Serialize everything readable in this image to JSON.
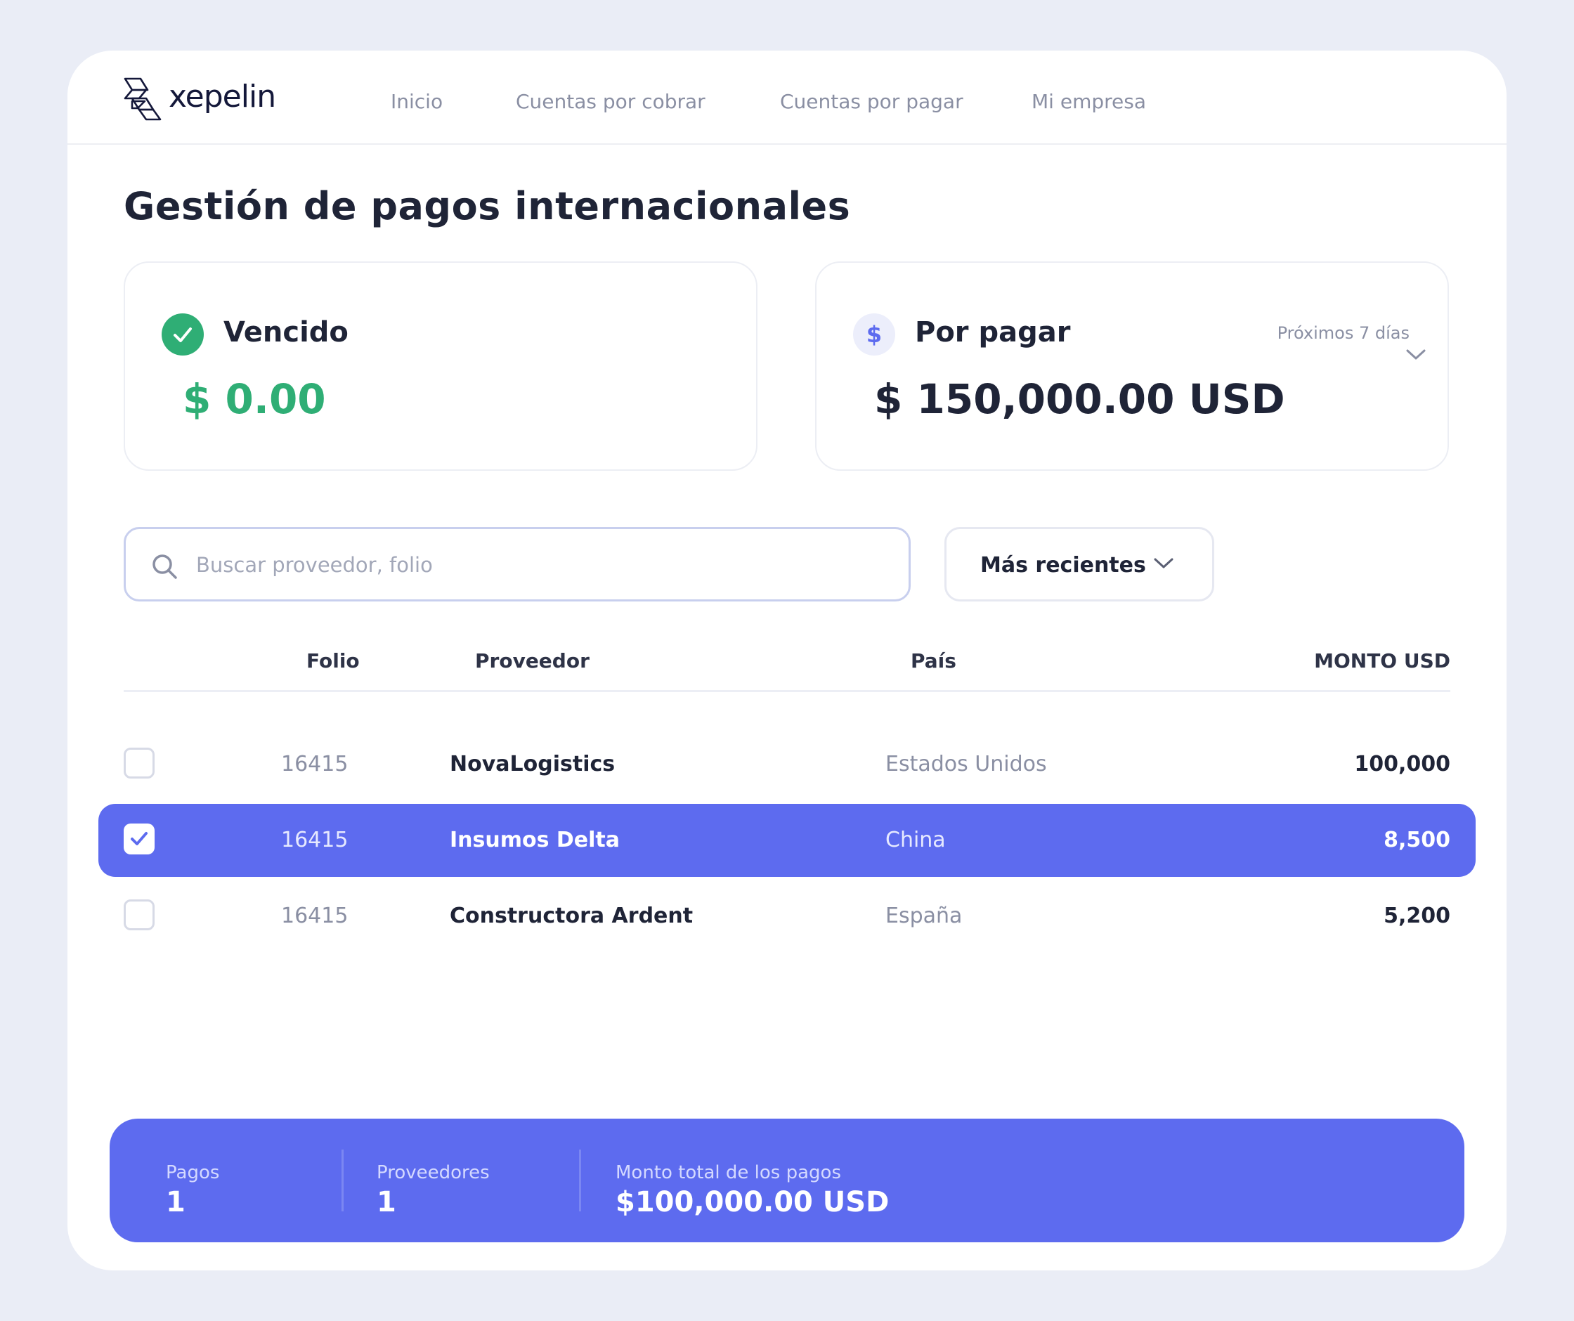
{
  "brand": {
    "name": "xepelin"
  },
  "nav": {
    "items": [
      "Inicio",
      "Cuentas por cobrar",
      "Cuentas por pagar",
      "Mi empresa"
    ]
  },
  "page": {
    "title": "Gestión de pagos internacionales"
  },
  "cards": {
    "vencido": {
      "label": "Vencido",
      "amount": "$ 0.00",
      "icon": "check-circle-icon",
      "color": "#2fae75"
    },
    "por_pagar": {
      "label": "Por pagar",
      "amount": "$ 150,000.00 USD",
      "period": "Próximos 7 días",
      "icon": "dollar-icon",
      "color": "#5d6bef"
    }
  },
  "search": {
    "placeholder": "Buscar proveedor, folio",
    "value": ""
  },
  "sort": {
    "label": "Más recientes"
  },
  "table": {
    "headers": {
      "folio": "Folio",
      "proveedor": "Proveedor",
      "pais": "País",
      "monto": "MONTO USD"
    },
    "rows": [
      {
        "folio": "16415",
        "proveedor": "NovaLogistics",
        "pais": "Estados Unidos",
        "monto": "100,000",
        "selected": false
      },
      {
        "folio": "16415",
        "proveedor": "Insumos Delta",
        "pais": "China",
        "monto": "8,500",
        "selected": true
      },
      {
        "folio": "16415",
        "proveedor": "Constructora Ardent",
        "pais": "España",
        "monto": "5,200",
        "selected": false
      }
    ]
  },
  "summary": {
    "pagos_label": "Pagos",
    "pagos_value": "1",
    "proveedores_label": "Proveedores",
    "proveedores_value": "1",
    "monto_label": "Monto total de los pagos",
    "monto_value": "$100,000.00 USD"
  },
  "colors": {
    "accent": "#5d6bef",
    "success": "#2fae75",
    "text": "#1f2437",
    "muted": "#8a8fa3",
    "background": "#eaedf6"
  }
}
